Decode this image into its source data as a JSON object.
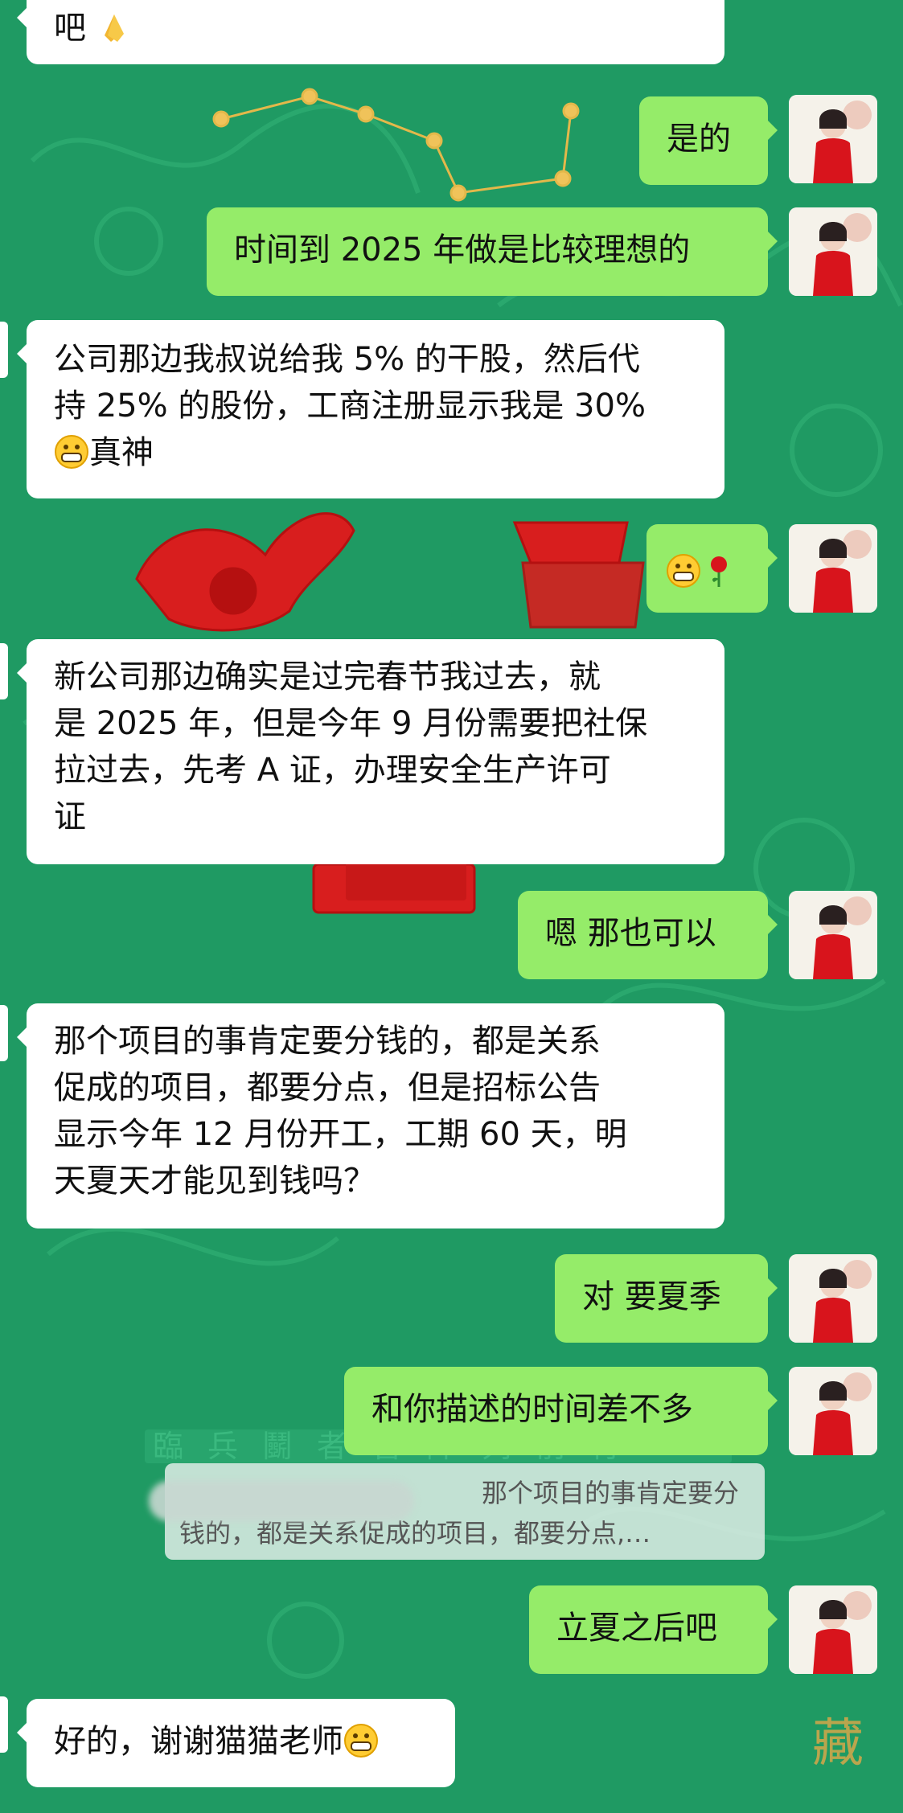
{
  "messages": [
    {
      "id": "m0",
      "side": "in",
      "text": "吧",
      "emoji": "folded-hands-emoji"
    },
    {
      "id": "m1",
      "side": "out",
      "text": "是的"
    },
    {
      "id": "m2",
      "side": "out",
      "text": "时间到 2025 年做是比较理想的"
    },
    {
      "id": "m3",
      "side": "in",
      "lines": [
        "公司那边我叔说给我 5% 的干股，然后代",
        "持 25% 的股份，工商注册显示我是 30%",
        "真神"
      ],
      "emoji": "grinning-face-emoji"
    },
    {
      "id": "m4",
      "side": "out",
      "emoji_only": [
        "grinning-face-emoji",
        "rose-emoji"
      ]
    },
    {
      "id": "m5",
      "side": "in",
      "lines": [
        "新公司那边确实是过完春节我过去，就",
        "是 2025 年，但是今年 9 月份需要把社保",
        "拉过去，先考 A 证，办理安全生产许可",
        "证"
      ]
    },
    {
      "id": "m6",
      "side": "out",
      "text": "嗯 那也可以"
    },
    {
      "id": "m7",
      "side": "in",
      "lines": [
        "那个项目的事肯定要分钱的，都是关系",
        "促成的项目，都要分点，但是招标公告",
        "显示今年 12 月份开工，工期 60 天，明",
        "天夏天才能见到钱吗？"
      ]
    },
    {
      "id": "m8",
      "side": "out",
      "text": "对 要夏季"
    },
    {
      "id": "m9",
      "side": "out",
      "text": "和你描述的时间差不多"
    },
    {
      "id": "m10",
      "side": "out",
      "text": "立夏之后吧"
    },
    {
      "id": "m11",
      "side": "in",
      "text": "好的，谢谢猫猫老师",
      "emoji": "grinning-face-emoji"
    }
  ],
  "quote": {
    "line1": "那个项目的事肯定要分",
    "line2": "钱的，都是关系促成的项目，都要分点,…"
  },
  "background": {
    "mural_text": "臨兵鬭者皆陣列前行",
    "corner_char": "藏"
  },
  "colors": {
    "background": "#1f9a63",
    "incoming": "#ffffff",
    "outgoing": "#95ec69"
  }
}
